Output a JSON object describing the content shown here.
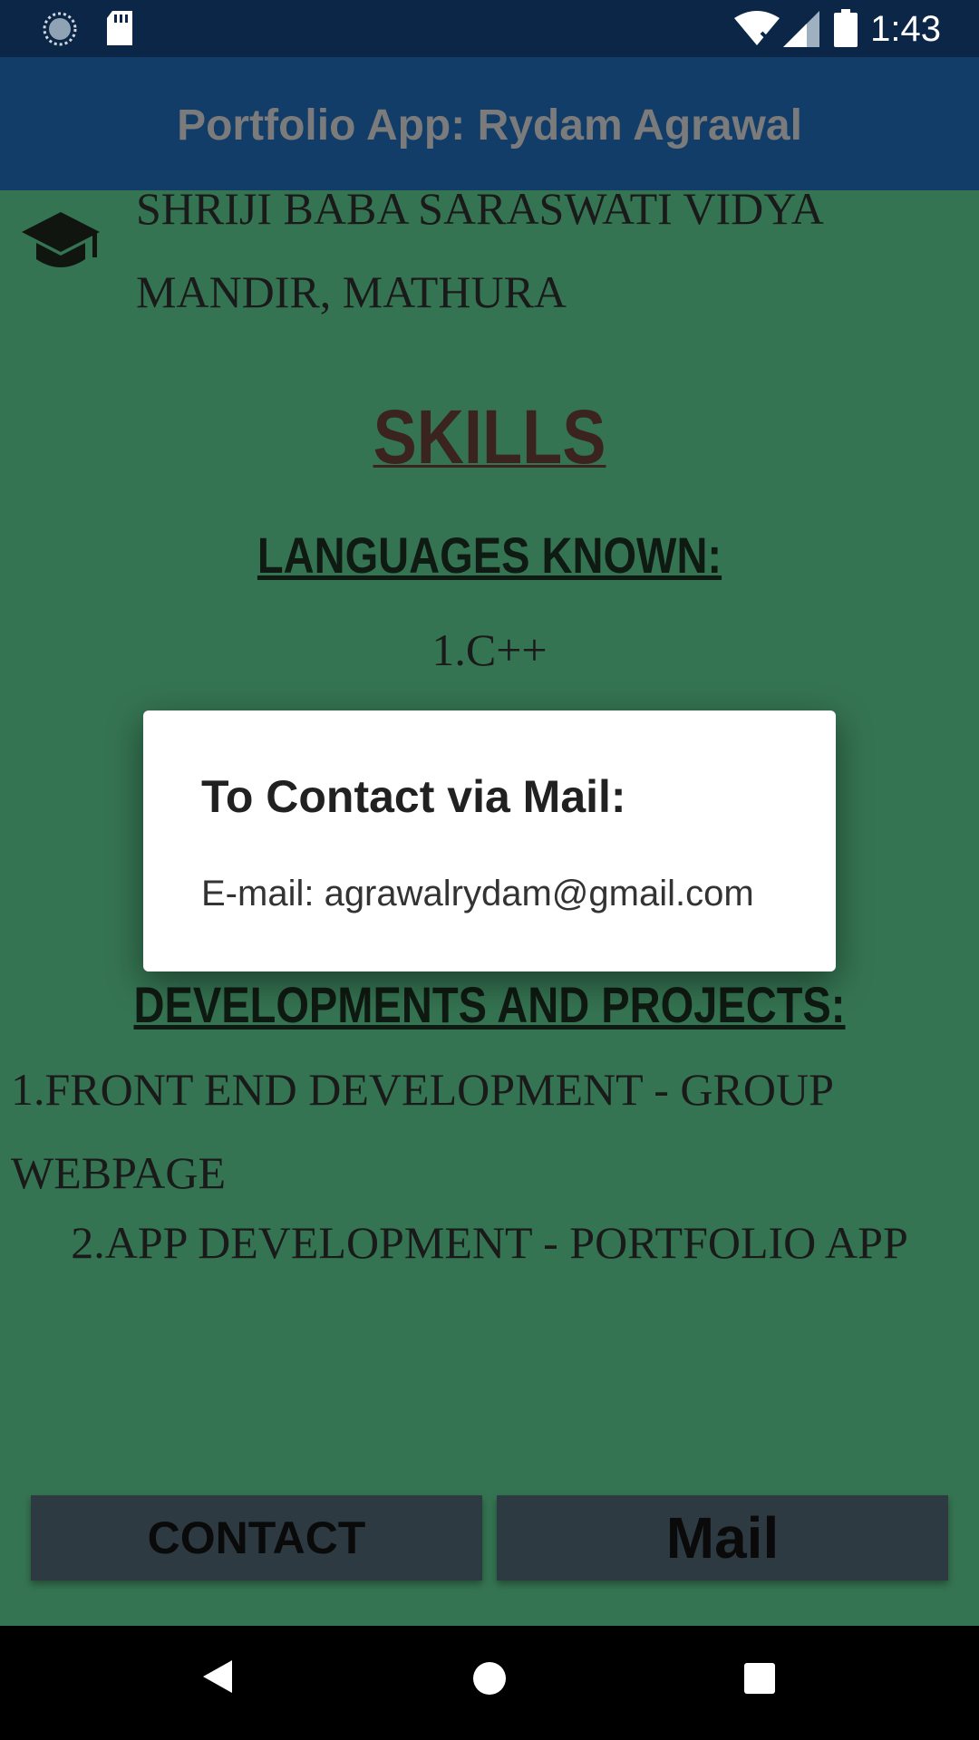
{
  "status_bar": {
    "time": "1:43",
    "icons": [
      "sync-icon",
      "sd-card-icon",
      "wifi-off-icon",
      "signal-icon",
      "battery-icon"
    ]
  },
  "app_bar": {
    "title": "Portfolio App: Rydam Agrawal"
  },
  "content": {
    "school_name": "SHRIJI BABA SARASWATI VIDYA MANDIR, MATHURA",
    "skills_heading": "SKILLS",
    "languages_heading": "LANGUAGES KNOWN:",
    "language_1": "1.C++",
    "projects_heading": "DEVELOPMENTS AND PROJECTS:",
    "project_1": "1.FRONT END DEVELOPMENT - GROUP WEBPAGE",
    "project_2": "2.APP DEVELOPMENT - PORTFOLIO APP"
  },
  "buttons": {
    "contact_label": "CONTACT",
    "mail_label": "Mail"
  },
  "dialog": {
    "title": "To Contact via Mail:",
    "message": "E-mail: agrawalrydam@gmail.com"
  },
  "colors": {
    "status_bar": "#0b2647",
    "app_bar": "#123d68",
    "content_bg": "#357452",
    "button_bg": "#2d3a42",
    "dialog_bg": "#ffffff"
  }
}
